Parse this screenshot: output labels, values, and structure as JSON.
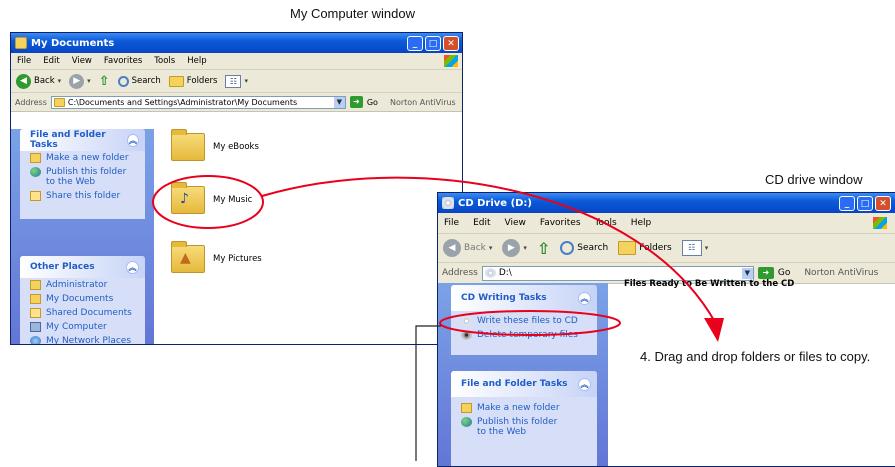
{
  "captions": {
    "my_computer": "My Computer window",
    "cd_drive": "CD drive window"
  },
  "win1": {
    "title": "My Documents",
    "menus": [
      "File",
      "Edit",
      "View",
      "Favorites",
      "Tools",
      "Help"
    ],
    "toolbar": {
      "back": "Back",
      "search": "Search",
      "folders": "Folders"
    },
    "address": {
      "label": "Address",
      "value": "C:\\Documents and Settings\\Administrator\\My Documents",
      "go": "Go",
      "norton": "Norton AntiVirus"
    },
    "file_tasks": {
      "title": "File and Folder Tasks",
      "items": [
        "Make a new folder",
        "Publish this folder to the Web",
        "Share this folder"
      ]
    },
    "other_places": {
      "title": "Other Places",
      "items": [
        "Administrator",
        "My Documents",
        "Shared Documents",
        "My Computer",
        "My Network Places"
      ]
    },
    "folders": [
      "My eBooks",
      "My Music",
      "My Pictures"
    ]
  },
  "win2": {
    "title": "CD Drive (D:)",
    "menus": [
      "File",
      "Edit",
      "View",
      "Favorites",
      "Tools",
      "Help"
    ],
    "toolbar": {
      "back": "Back",
      "search": "Search",
      "folders": "Folders"
    },
    "address": {
      "label": "Address",
      "value": "D:\\",
      "go": "Go",
      "norton": "Norton AntiVirus"
    },
    "cd_tasks": {
      "title": "CD Writing Tasks",
      "items": [
        "Write these files to CD",
        "Delete temporary files"
      ]
    },
    "file_tasks": {
      "title": "File and Folder Tasks",
      "items": [
        "Make a new folder",
        "Publish this folder to the Web"
      ]
    },
    "header": "Files Ready to Be Written to the CD"
  },
  "note": "4. Drag and drop folders or files to copy.",
  "colors": {
    "annotation": "#e8001c",
    "xp_blue": "#0a5bd9",
    "task_link": "#215dc6"
  }
}
